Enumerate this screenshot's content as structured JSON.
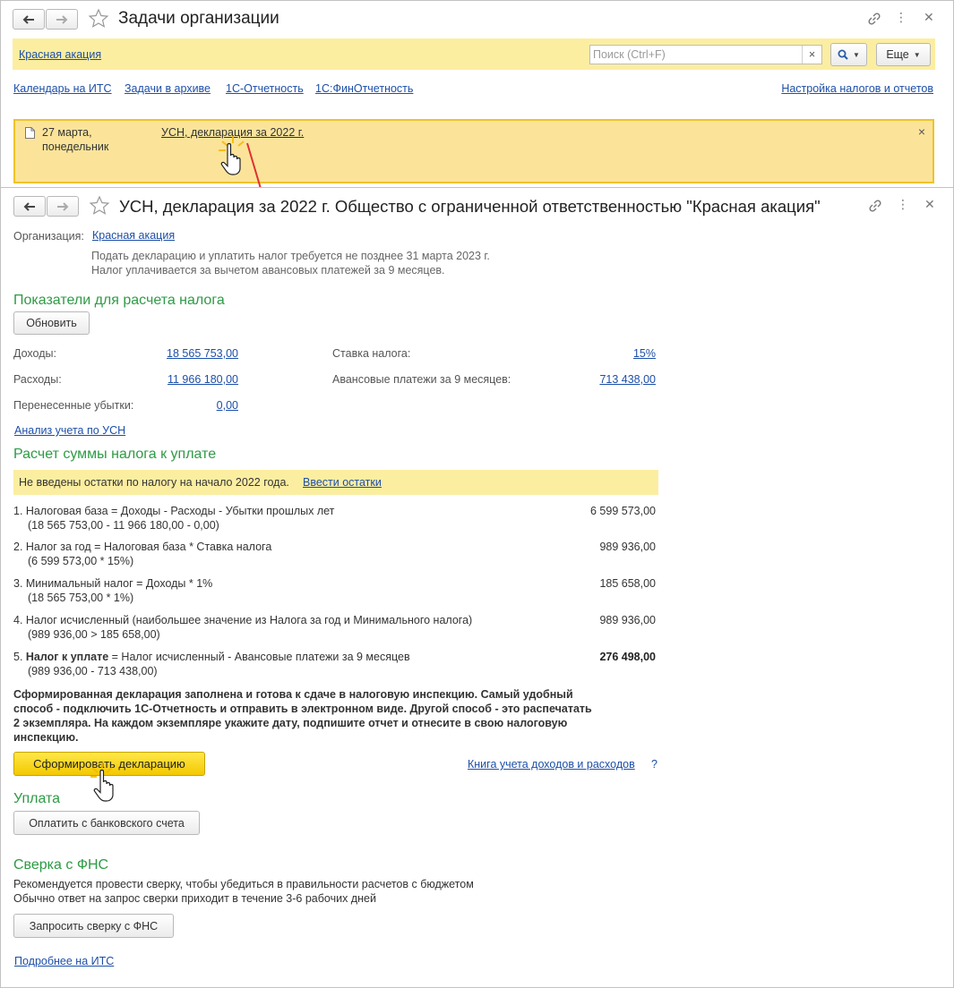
{
  "tasks_window": {
    "title": "Задачи организации",
    "org_link": "Красная акация",
    "search_placeholder": "Поиск (Ctrl+F)",
    "search_clear": "×",
    "more_button": "Еще",
    "links": [
      "Календарь на ИТС",
      "Задачи в архиве",
      "1С-Отчетность",
      "1С:ФинОтчетность"
    ],
    "settings_link": "Настройка налогов и отчетов",
    "task": {
      "date_line1": "27 марта,",
      "date_line2": "понедельник",
      "title": "УСН, декларация за 2022 г.",
      "close": "×"
    }
  },
  "decl_window": {
    "title": "УСН, декларация за 2022 г. Общество с ограниченной ответственностью \"Красная акация\"",
    "org_label": "Организация:",
    "org_link": "Красная акация",
    "note1": "Подать декларацию и уплатить налог требуется не позднее 31 марта 2023 г.",
    "note2": "Налог уплачивается за вычетом авансовых платежей за 9 месяцев.",
    "indicators_header": "Показатели для расчета налога",
    "refresh_button": "Обновить",
    "income_label": "Доходы:",
    "income_value": "18 565 753,00",
    "expenses_label": "Расходы:",
    "expenses_value": "11 966 180,00",
    "losses_label": "Перенесенные убытки:",
    "losses_value": "0,00",
    "rate_label": "Ставка налога:",
    "rate_value": "15%",
    "advance_label": "Авансовые платежи за 9 месяцев:",
    "advance_value": "713 438,00",
    "analysis_link": "Анализ учета по УСН",
    "calc_header": "Расчет суммы налога к уплате",
    "warning_text": "Не введены остатки по налогу на начало 2022 года.",
    "warning_link": "Ввести остатки",
    "calc_rows": [
      {
        "line1": "1. Налоговая база = Доходы - Расходы - Убытки прошлых лет",
        "line2": "(18 565 753,00 - 11 966 180,00 - 0,00)",
        "value": "6 599 573,00"
      },
      {
        "line1": "2. Налог за год = Налоговая база * Ставка налога",
        "line2": "(6 599 573,00 * 15%)",
        "value": "989 936,00"
      },
      {
        "line1": "3. Минимальный налог = Доходы * 1%",
        "line2": "(18 565 753,00 * 1%)",
        "value": "185 658,00"
      },
      {
        "line1": "4. Налог исчисленный (наибольшее значение из Налога за год и Минимального налога)",
        "line2": "(989 936,00 > 185 658,00)",
        "value": "989 936,00"
      }
    ],
    "row5_prefix": "5. ",
    "row5_bold": "Налог к уплате",
    "row5_rest": " = Налог исчисленный - Авансовые платежи за 9 месяцев",
    "row5_line2": "(989 936,00 - 713 438,00)",
    "row5_value": "276 498,00",
    "ready_text": [
      "Сформированная декларация заполнена и готова к сдаче в налоговую инспекцию. Самый удобный",
      "способ - подключить 1С-Отчетность и отправить в электронном виде. Другой способ - это распечатать",
      "2 экземпляра. На каждом экземпляре укажите дату, подпишите отчет и отнесите в свою налоговую",
      "инспекцию."
    ],
    "form_button": "Сформировать декларацию",
    "book_link": "Книга учета доходов и расходов",
    "help_mark": "?",
    "payment_header": "Уплата",
    "pay_button": "Оплатить с банковского счета",
    "fns_header": "Сверка с ФНС",
    "fns_note1": "Рекомендуется провести сверку, чтобы убедиться в правильности расчетов с бюджетом",
    "fns_note2": "Обычно ответ на запрос сверки приходит в течение 3-6 рабочих дней",
    "fns_button": "Запросить сверку с ФНС",
    "more_link": "Подробнее на ИТС"
  },
  "colors": {
    "link": "#1d4fa8",
    "section_green": "#2e9b45",
    "yellow_bar": "#fbeea1",
    "task_panel": "#fbe49a",
    "primary_button": "#f3c800"
  }
}
